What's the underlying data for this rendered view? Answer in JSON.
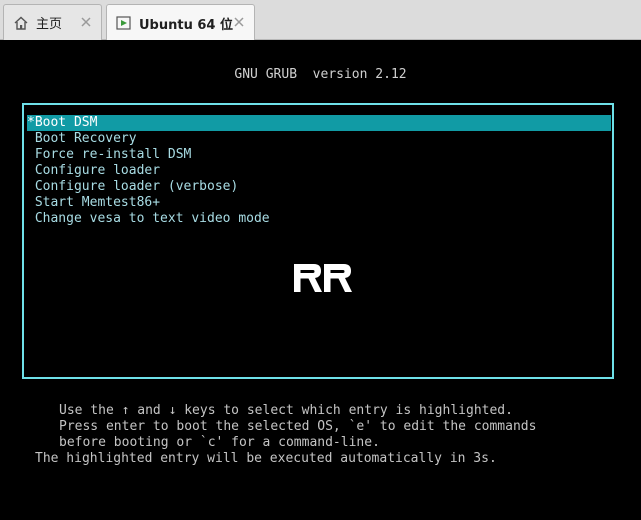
{
  "tabs": [
    {
      "label": "主页",
      "icon": "home-icon",
      "active": false
    },
    {
      "label": "Ubuntu 64 位",
      "icon": "vm-icon",
      "active": true
    }
  ],
  "grub": {
    "title": "GNU GRUB  version 2.12",
    "menu_items": [
      "*Boot DSM",
      " Boot Recovery",
      " Force re-install DSM",
      " Configure loader",
      " Configure loader (verbose)",
      " Start Memtest86+",
      " Change vesa to text video mode"
    ],
    "selected_index": 0,
    "logo_text": "RR",
    "help": [
      "Use the ↑ and ↓ keys to select which entry is highlighted.",
      "Press enter to boot the selected OS, `e' to edit the commands",
      "before booting or `c' for a command-line."
    ],
    "countdown": "The highlighted entry will be executed automatically in 3s."
  },
  "colors": {
    "border": "#6ee0e8",
    "selection": "#119ba5",
    "menu_text": "#a8dce4",
    "vm_icon": "#3a9a3a"
  }
}
